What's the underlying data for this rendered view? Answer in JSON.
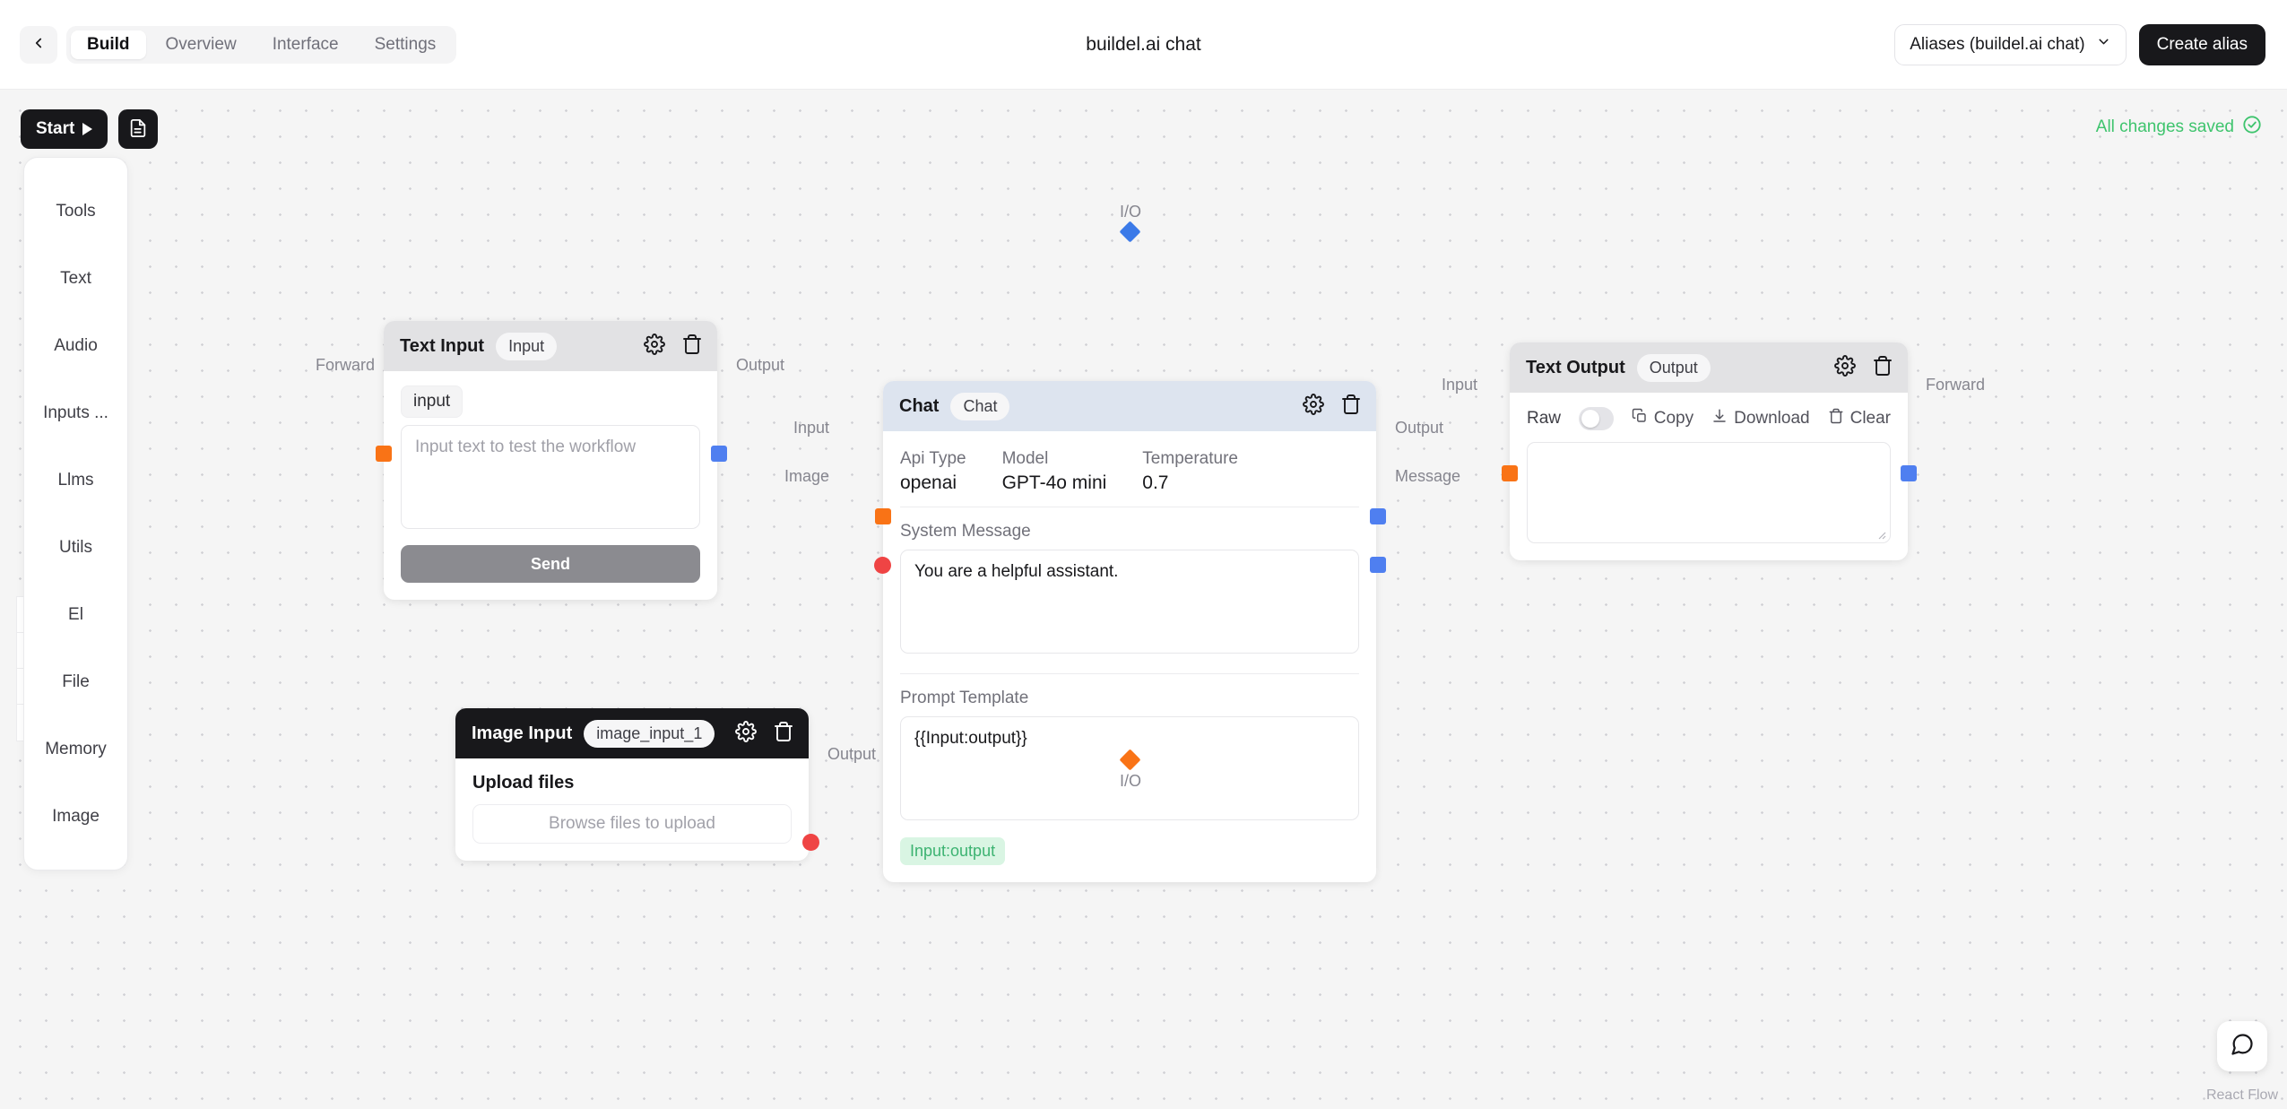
{
  "header": {
    "back_icon": "chevron-left-icon",
    "tabs": [
      {
        "label": "Build",
        "active": true
      },
      {
        "label": "Overview",
        "active": false
      },
      {
        "label": "Interface",
        "active": false
      },
      {
        "label": "Settings",
        "active": false
      }
    ],
    "title": "buildel.ai chat",
    "alias_select": "Aliases (buildel.ai chat)",
    "alias_caret_icon": "chevron-down-icon",
    "create_alias": "Create alias"
  },
  "canvas_toolbar": {
    "start_label": "Start",
    "start_icon": "play-icon",
    "doc_icon": "document-icon",
    "saved_label": "All changes saved",
    "saved_icon": "check-circle-icon",
    "saved_color": "#3ec46d"
  },
  "blocks_panel": {
    "items": [
      {
        "label": "Tools"
      },
      {
        "label": "Text"
      },
      {
        "label": "Audio"
      },
      {
        "label": "Inputs ..."
      },
      {
        "label": "Llms"
      },
      {
        "label": "Utils"
      },
      {
        "label": "El"
      },
      {
        "label": "File"
      },
      {
        "label": "Memory"
      },
      {
        "label": "Image"
      }
    ]
  },
  "flow_controls": {
    "buttons": [
      {
        "icon": "zoom-out-icon"
      },
      {
        "icon": "fit-view-icon"
      },
      {
        "icon": "lock-horizontal-icon"
      },
      {
        "icon": "lock-vertical-icon"
      }
    ]
  },
  "nodes": {
    "text_input": {
      "title": "Text Input",
      "chip": "Input",
      "gear_icon": "gear-icon",
      "trash_icon": "trash-icon",
      "tag": "input",
      "textarea_placeholder": "Input text to test the workflow",
      "textarea_value": "",
      "send_label": "Send",
      "handles": {
        "left_label": "Forward",
        "right_label": "Output"
      }
    },
    "image_input": {
      "title": "Image Input",
      "chip": "image_input_1",
      "gear_icon": "gear-icon",
      "trash_icon": "trash-icon",
      "upload_title": "Upload files",
      "dropzone_label": "Browse files to upload",
      "handles": {
        "right_label": "Output"
      }
    },
    "chat": {
      "title": "Chat",
      "chip": "Chat",
      "gear_icon": "gear-icon",
      "trash_icon": "trash-icon",
      "params": [
        {
          "key": "Api Type",
          "value": "openai"
        },
        {
          "key": "Model",
          "value": "GPT-4o mini"
        },
        {
          "key": "Temperature",
          "value": "0.7"
        }
      ],
      "system_message_label": "System Message",
      "system_message_value": "You are a helpful assistant.",
      "prompt_template_label": "Prompt Template",
      "prompt_template_value": "{{Input:output}}",
      "token_pill": "Input:output",
      "handles": {
        "top_label": "I/O",
        "bottom_label": "I/O",
        "left_input_label": "Input",
        "left_image_label": "Image",
        "right_output_label": "Output",
        "right_message_label": "Message"
      }
    },
    "text_output": {
      "title": "Text Output",
      "chip": "Output",
      "gear_icon": "gear-icon",
      "trash_icon": "trash-icon",
      "raw_label": "Raw",
      "raw_on": false,
      "copy_label": "Copy",
      "copy_icon": "copy-icon",
      "download_label": "Download",
      "download_icon": "download-icon",
      "clear_label": "Clear",
      "clear_icon": "trash-icon",
      "output_value": "",
      "handles": {
        "left_label": "Input",
        "right_label": "Forward"
      }
    }
  },
  "footer": {
    "attribution": "React Flow",
    "chat_bubble_icon": "chat-bubble-icon"
  },
  "colors": {
    "handle_orange": "#f97316",
    "handle_blue": "#4f7ff0",
    "handle_red": "#ef4444",
    "accent_dark": "#18181b"
  }
}
